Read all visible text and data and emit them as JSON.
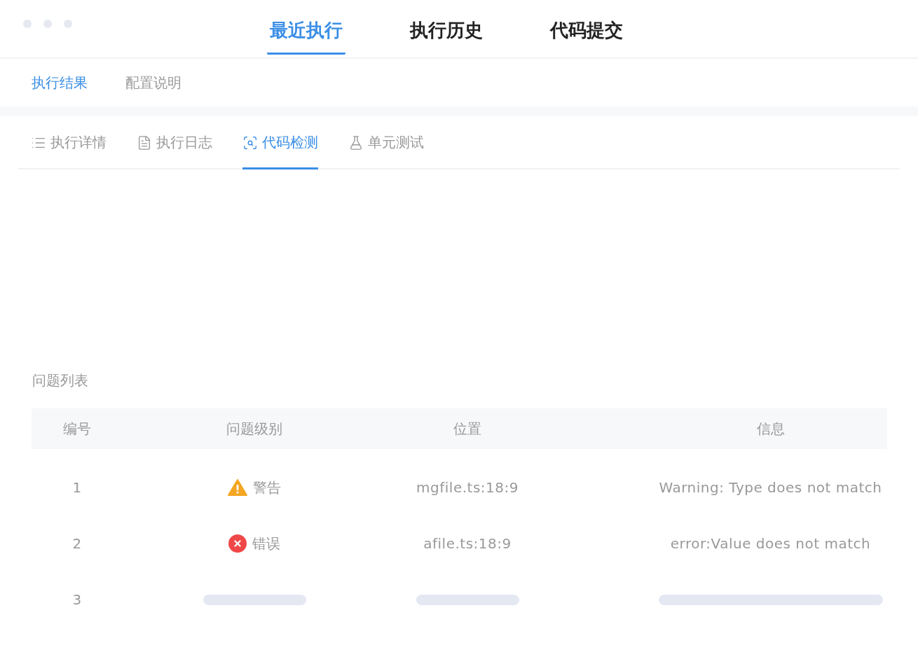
{
  "main_tabs": [
    {
      "label": "最近执行",
      "selected": true
    },
    {
      "label": "执行历史",
      "selected": false
    },
    {
      "label": "代码提交",
      "selected": false
    }
  ],
  "sub_tabs": [
    {
      "label": "执行结果",
      "selected": true
    },
    {
      "label": "配置说明",
      "selected": false
    }
  ],
  "detail_tabs": [
    {
      "label": "执行详情",
      "selected": false,
      "kind": "list"
    },
    {
      "label": "执行日志",
      "selected": false,
      "kind": "log"
    },
    {
      "label": "代码检测",
      "selected": true,
      "kind": "scan"
    },
    {
      "label": "单元测试",
      "selected": false,
      "kind": "test"
    }
  ],
  "issues": {
    "title": "问题列表",
    "columns": [
      "编号",
      "问题级别",
      "位置",
      "信息"
    ],
    "rows": [
      {
        "kind": "warning",
        "number": "1",
        "level_label": "警告",
        "location": "mgfile.ts:18:9",
        "message": "Warning: Type does not match"
      },
      {
        "kind": "error",
        "number": "2",
        "level_label": "错误",
        "location": "afile.ts:18:9",
        "message": "error:Value does not match"
      },
      {
        "kind": "placeholder",
        "number": "3"
      }
    ]
  }
}
